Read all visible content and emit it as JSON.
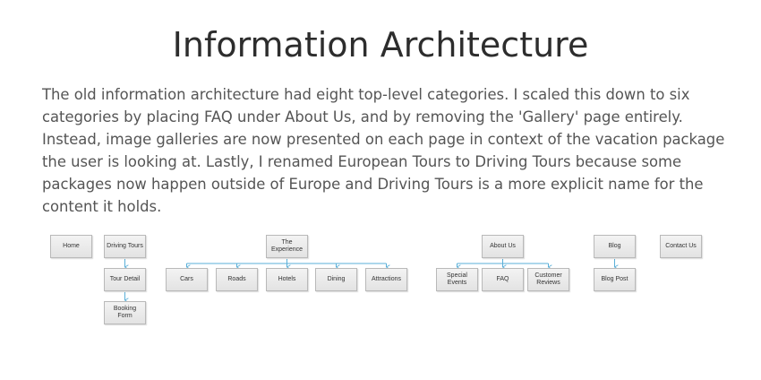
{
  "title": "Information Architecture",
  "description": "The old information architecture had eight top-level categories. I scaled this down to six categories by placing FAQ under About Us, and by removing the 'Gallery' page entirely. Instead, image galleries are now presented on each page in context of the vacation package the user is looking at. Lastly, I renamed European Tours to Driving Tours because some packages now happen outside of Europe and Driving Tours is a more explicit name for the content it holds.",
  "diagram": {
    "connector_color": "#5aafd8",
    "nodes": {
      "home": "Home",
      "driving_tours": "Driving Tours",
      "tour_detail": "Tour Detail",
      "booking_form": "Booking Form",
      "the_experience": "The Experience",
      "cars": "Cars",
      "roads": "Roads",
      "hotels": "Hotels",
      "dining": "Dining",
      "attractions": "Attractions",
      "about_us": "About Us",
      "special_events": "Special Events",
      "faq": "FAQ",
      "customer_reviews": "Customer Reviews",
      "blog": "Blog",
      "blog_post": "Blog Post",
      "contact_us": "Contact Us"
    }
  }
}
